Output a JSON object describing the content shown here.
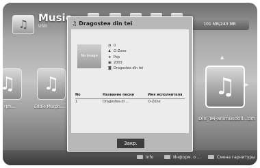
{
  "header": {
    "title": "Music",
    "subtitle": "USB",
    "icon": "music-note-icon",
    "storage": "101 MB/243 MB"
  },
  "grid": {
    "left_caption": "rph...",
    "item_caption": "Eddie Murph...",
    "selected_caption": "Din_Tei-animusdoll...om"
  },
  "bottom_bar": {
    "hint_left": "Info",
    "hint_middle": "Информ. о ...",
    "hint_right": "Смена гарнитуры"
  },
  "dialog": {
    "title": "Dragostea din tei",
    "thumbnail_label": "No Image",
    "meta": {
      "time": "0",
      "artist": "O-Zone",
      "genre": "Pop",
      "year": "2003",
      "album": "Dragostea din tei"
    },
    "table": {
      "headers": [
        "No",
        "Название песни",
        "Имя исполнителя"
      ],
      "rows": [
        [
          "1",
          "Dragostea di ...",
          "O-Zone"
        ]
      ]
    },
    "close_label": "Закр."
  }
}
